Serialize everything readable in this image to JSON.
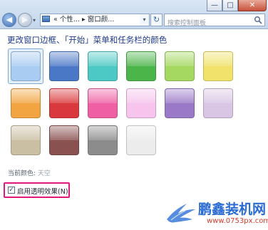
{
  "window": {
    "minimize_glyph": "—",
    "maximize_glyph": "□",
    "close_glyph": "✕"
  },
  "nav": {
    "back_glyph": "◀",
    "forward_glyph": "▶",
    "dropdown_glyph": "▾"
  },
  "address": {
    "prefix": "«",
    "crumb1": "个性...",
    "sep": "▸",
    "crumb2": "窗口颜...",
    "dropdown_glyph": "▾",
    "refresh_glyph": "↻"
  },
  "search": {
    "placeholder": "搜索控制面板"
  },
  "main": {
    "heading": "更改窗口边框、「开始」菜单和任务栏的颜色",
    "current_label": "当前颜色:",
    "current_value": "天空",
    "transparency_label": "启用透明效果(N)",
    "transparency_checked": true,
    "checkmark": "✓"
  },
  "swatches": [
    {
      "name": "sky",
      "color": "#a8ccf2",
      "selected": true
    },
    {
      "name": "twilight",
      "color": "#4b78c6"
    },
    {
      "name": "sea",
      "color": "#4cc9c4"
    },
    {
      "name": "leaf",
      "color": "#4cb54a"
    },
    {
      "name": "lime",
      "color": "#a4d860"
    },
    {
      "name": "yellow",
      "color": "#f0e26a"
    },
    {
      "name": "orange",
      "color": "#f2a443"
    },
    {
      "name": "red",
      "color": "#d9393c"
    },
    {
      "name": "pink",
      "color": "#ee5fa3"
    },
    {
      "name": "light-pink",
      "color": "#f6c4ec"
    },
    {
      "name": "violet",
      "color": "#9a7ac8"
    },
    {
      "name": "lavender",
      "color": "#d8c6e4"
    },
    {
      "name": "taupe",
      "color": "#cbbfa3"
    },
    {
      "name": "chocolate",
      "color": "#8a5151"
    },
    {
      "name": "slate",
      "color": "#8c8c8c"
    },
    {
      "name": "frost",
      "color": "#ececec"
    }
  ],
  "watermark": {
    "title": "鹏鑫装机网",
    "url": "www.0753px.com"
  }
}
